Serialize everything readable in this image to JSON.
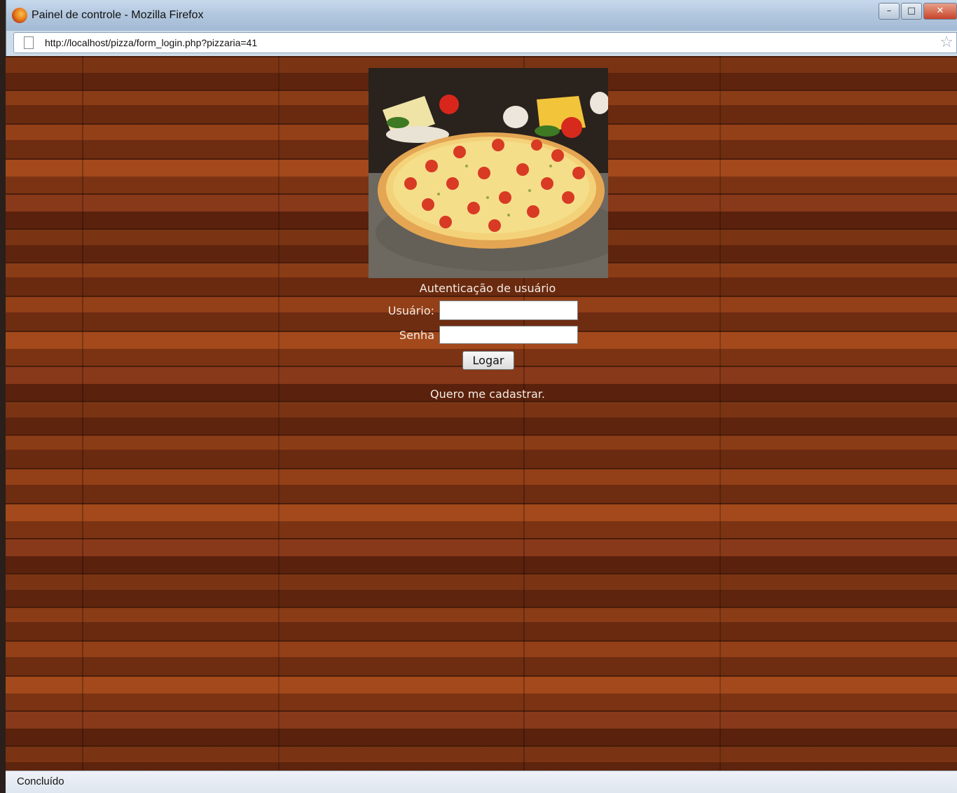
{
  "window": {
    "title": "Painel de controle - Mozilla Firefox",
    "minimize_label": "–",
    "maximize_label": "□",
    "close_label": "✕"
  },
  "addressbar": {
    "url": "http://localhost/pizza/form_login.php?pizzaria=41",
    "bookmark_glyph": "☆"
  },
  "login": {
    "heading": "Autenticação de usuário",
    "username_label": "Usuário:",
    "username_value": "",
    "password_label": "Senha",
    "password_value": "",
    "submit_label": "Logar",
    "register_link": "Quero me cadastrar."
  },
  "statusbar": {
    "text": "Concluído"
  },
  "colors": {
    "wood": "#6b2a10",
    "text_light": "#f4ece2"
  }
}
